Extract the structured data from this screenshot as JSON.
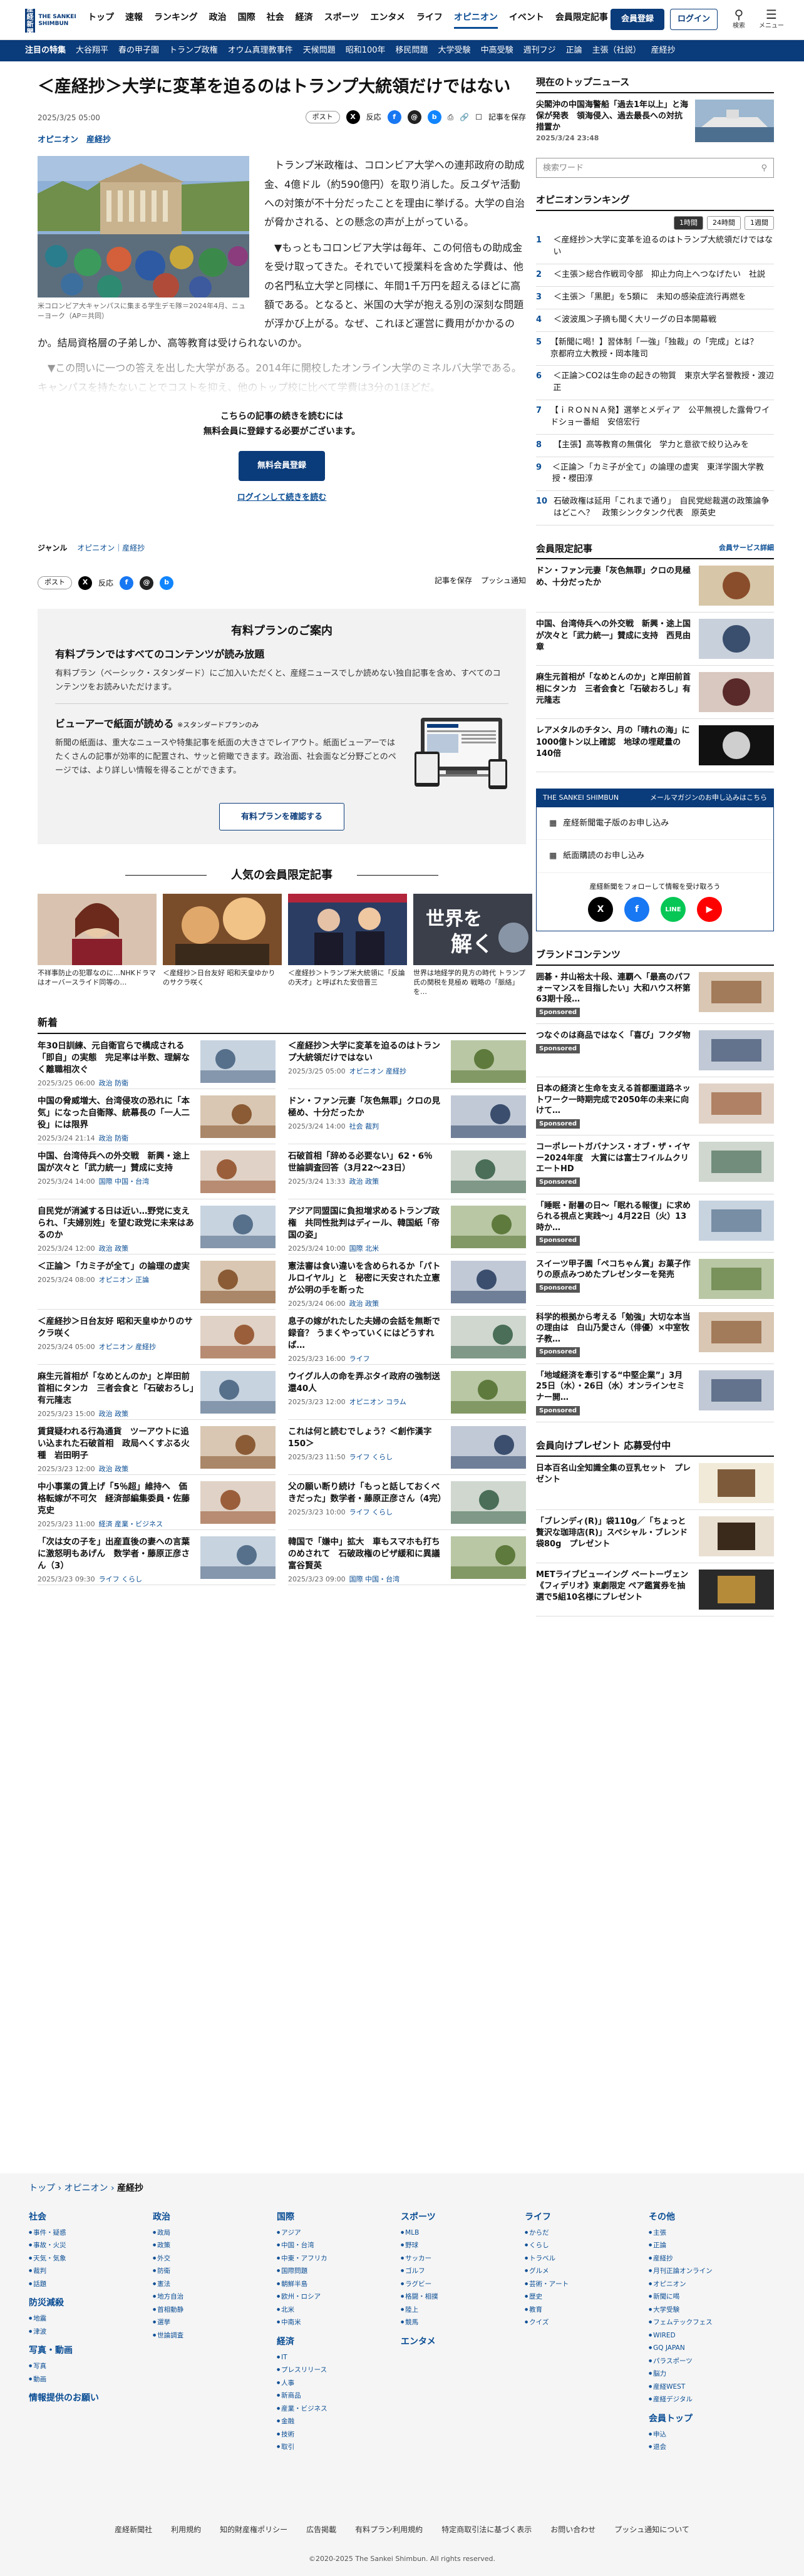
{
  "header": {
    "logo_text": "THE SANKEI SHIMBUN",
    "logo_mark": "産経新聞",
    "nav": [
      "トップ",
      "速報",
      "ランキング",
      "政治",
      "国際",
      "社会",
      "経済",
      "スポーツ",
      "エンタメ",
      "ライフ",
      "オピニオン",
      "イベント",
      "会員限定記事"
    ],
    "active_nav": "オピニオン",
    "register_label": "会員登録",
    "login_label": "ログイン",
    "search_label": "検索",
    "menu_label": "メニュー"
  },
  "topic_bar": {
    "label": "注目の特集",
    "items": [
      "大谷翔平",
      "春の甲子園",
      "トランプ政権",
      "オウム真理教事件",
      "天候問題",
      "昭和100年",
      "移民問題",
      "大学受験",
      "中高受験",
      "週刊フジ",
      "正論",
      "主張（社説）",
      "産経抄"
    ]
  },
  "article": {
    "headline": "＜産経抄＞大学に変革を迫るのはトランプ大統領だけではない",
    "date": "2025/3/25 05:00",
    "share_post": "ポスト",
    "share_reaction": "反応",
    "save_label": "記事を保存",
    "categories": [
      "オピニオン",
      "産経抄"
    ],
    "photo_caption": "米コロンビア大キャンパスに集まる学生デモ隊＝2024年4月、ニューヨーク（AP＝共同）",
    "para1": "トランプ米政権は、コロンビア大学への連邦政府の助成金、4億ドル（約590億円）を取り消した。反ユダヤ活動への対策が不十分だったことを理由に挙げる。大学の自治が脅かされる、との懸念の声が上がっている。",
    "para2": "▼もっともコロンビア大学は毎年、この何倍もの助成金を受け取ってきた。それでいて授業料を含めた学費は、他の名門私立大学と同様に、年間1千万円を超えるほどに高額である。となると、米国の大学が抱える別の深刻な問題が浮かび上がる。なぜ、これほど運営に費用がかかるのか。結局資格層の子弟しか、高等教育は受けられないのか。",
    "para3": "▼この問いに一つの答えを出した大学がある。2014年に開校したオンライン大学のミネルバ大学である。キャンパスを持たないことでコストを抑え、他のトップ校に比べて学費は3分の1ほどだ。",
    "paywall_line1": "こちらの記事の続きを読むには",
    "paywall_line2": "無料会員に登録する必要がございます。",
    "paywall_button": "無料会員登録",
    "paywall_login": "ログインして続きを読む",
    "genre_label": "ジャンル",
    "genre_values": "オピニオン｜産経抄",
    "push_label": "プッシュ通知"
  },
  "plan": {
    "title": "有料プランのご案内",
    "h1": "有料プランではすべてのコンテンツが読み放題",
    "p1": "有料プラン（ベーシック・スタンダード）にご加入いただくと、産経ニュースでしか読めない独自記事を含め、すべてのコンテンツをお読みいただけます。",
    "h2": "ビューアーで紙面が読める",
    "h2_note": "※スタンダードプランのみ",
    "p2": "新聞の紙面は、重大なニュースや特集記事を紙面の大きさでレイアウト。紙面ビューアーではたくさんの記事が効率的に配置され、サッと俯瞰できます。政治面、社会面など分野ごとのページでは、より詳しい情報を得ることができます。",
    "button": "有料プランを確認する"
  },
  "popular": {
    "title": "人気の会員限定記事",
    "items": [
      {
        "title": "不祥事防止の犯罪なのに…NHKドラマはオーバースライド同等の…"
      },
      {
        "title": "＜産経抄＞日台友好 昭和天皇ゆかりのサクラ咲く"
      },
      {
        "title": "＜産経抄＞トランプ米大統領に「反論の天才」と呼ばれた安倍晋三"
      },
      {
        "title": "世界は地経学的見方の時代 トランプ氏の関税を見極め 戦略の「脈絡」を…"
      }
    ]
  },
  "new_list": {
    "title": "新着",
    "items": [
      {
        "title": "年30日訓練、元自衛官らで構成される「即自」の実態　完足率は半数、理解なく離職相次ぐ",
        "date": "2025/3/25 06:00",
        "cat": "政治 防衛"
      },
      {
        "title": "＜産経抄＞大学に変革を迫るのはトランプ大統領だけではない",
        "date": "2025/3/25 05:00",
        "cat": "オピニオン 産経抄"
      },
      {
        "title": "中国の脅威増大、台湾侵攻の恐れに「本気」になった自衛隊、統幕長の「一人二役」には限界",
        "date": "2025/3/24 21:14",
        "cat": "政治 防衛"
      },
      {
        "title": "ドン・ファン元妻「灰色無罪」クロの見極め、十分だったか",
        "date": "2025/3/24 14:00",
        "cat": "社会 裁判"
      },
      {
        "title": "中国、台湾侍兵への外交戦　新興・途上国が次々と「武力統一」賛成に支持",
        "date": "2025/3/24 14:00",
        "cat": "国際 中国・台湾"
      },
      {
        "title": "石破首相「辞める必要ない」62・6％　世論調査回答（3月22～23日）",
        "date": "2025/3/24 13:33",
        "cat": "政治 政策"
      },
      {
        "title": "自民党が消滅する日は近い…野党に支えられ、「夫婦別姓」を望む政党に未来はあるのか",
        "date": "2025/3/24 12:00",
        "cat": "政治 政策"
      },
      {
        "title": "アジア同盟国に負担増求めるトランプ政権　共同性批判はディール、韓国紙「帝国の姿」",
        "date": "2025/3/24 10:00",
        "cat": "国際 北米"
      },
      {
        "title": "＜正論＞「カミ子が全て」の論理の虚実",
        "date": "2025/3/24 08:00",
        "cat": "オピニオン 正論"
      },
      {
        "title": "憲法審は食い違いを含められるか「パトルロイヤル」と　秘密に天安された立憲が公明の手を断った",
        "date": "2025/3/24 06:00",
        "cat": "政治 政策"
      },
      {
        "title": "＜産経抄＞日台友好 昭和天皇ゆかりのサクラ咲く",
        "date": "2025/3/24 05:00",
        "cat": "オピニオン 産経抄"
      },
      {
        "title": "息子の嫁がれたした夫婦の会話を無断で録音？ うまくやっていくにはどうすれば…",
        "date": "2025/3/23 16:00",
        "cat": "ライフ"
      },
      {
        "title": "麻生元首相が「なめとんのか」と岸田前首相にタンカ　三者会食と「石破おろし」有元隆志",
        "date": "2025/3/23 15:00",
        "cat": "政治 政策"
      },
      {
        "title": "ウイグル人の命を弄ぶタイ政府の強制送還40人",
        "date": "2025/3/23 12:00",
        "cat": "オピニオン コラム"
      },
      {
        "title": "賃貸疑われる行為通貨　ツーアウトに追い込まれた石破首相　政局へくすぶる火種　岩田明子",
        "date": "2025/3/23 12:00",
        "cat": "政治 政策"
      },
      {
        "title": "これは何と読むでしょう？＜創作漢字150＞",
        "date": "2025/3/23 11:50",
        "cat": "ライフ くらし"
      },
      {
        "title": "中小事業の賃上げ「5％超」維持へ　価格転嫁が不可欠　経済部編集委員・佐藤克史",
        "date": "2025/3/23 11:00",
        "cat": "経済 産業・ビジネス"
      },
      {
        "title": "父の願い断り続け「もっと話しておくべきだった」数学者・藤原正彦さん（4完）",
        "date": "2025/3/23 10:00",
        "cat": "ライフ くらし"
      },
      {
        "title": "「次は女の子を」出産直後の妻への言葉に激怒明もあげん　数学者・藤原正彦さん（3）",
        "date": "2025/3/23 09:30",
        "cat": "ライフ くらし"
      },
      {
        "title": "韓国で「嫌中」拡大　車もスマホも打ちのめされて　石破政権のビザ緩和に異議　富谷賢英",
        "date": "2025/3/23 09:00",
        "cat": "国際 中国・台湾"
      }
    ]
  },
  "sidebar": {
    "top_news_h": "現在のトップニュース",
    "top_news_t": "尖閣沖の中国海警船「過去1年以上」と海保が発表　領海侵入、過去最長への対抗措置か",
    "top_news_d": "2025/3/24 23:48",
    "search_placeholder": "検索ワード",
    "ranking_h": "オピニオンランキング",
    "ranking_tabs": [
      "1時間",
      "24時間",
      "1週間"
    ],
    "ranking": [
      "＜産経抄＞大学に変革を迫るのはトランプ大統領だけではない",
      "＜主張＞総合作戦司令部　抑止力向上へつなげたい　社説",
      "＜主張＞「黒肥」を5類に　未知の感染症流行再燃を",
      "＜波波風＞子摘も聞く大リーグの日本開幕戦",
      "【新聞に喝！】習体制「一強」「独裁」の「完成」とは？　京都府立大教授・岡本隆司",
      "＜正論＞CO2は生命の起きの物質　東京大学名誉教授・渡辺正",
      "【ｉＲＯＮＮＡ発】選挙とメディア　公平無視した露骨ワイドショー番組　安倍宏行",
      "【主張】高等教育の無償化　学力と意欲で絞り込みを",
      "＜正論＞「カミ子が全て」の論理の虚実　東洋学園大学教授・櫻田淳",
      "石破政権は延用「これまで通り」　自民党総裁選の政策論争はどこへ？　政策シンクタンク代表　原英史"
    ],
    "member_h": "会員限定記事",
    "member_service": "会員サービス詳細",
    "member": [
      "ドン・ファン元妻「灰色無罪」クロの見極め、十分だったか",
      "中国、台湾侍兵への外交戦　新興・途上国が次々と「武力統一」賛成に支持　西見由章",
      "麻生元首相が「なめとんのか」と岸田前首相にタンカ　三者会食と「石破おろし」有元隆志",
      "レアメタルのチタン、月の「晴れの海」に1000億トン以上確認　地球の埋蔵量の140倍"
    ],
    "sankei_box_title": "THE SANKEI SHIMBUN",
    "sankei_box_right": "メールマガジンのお申し込みはこちら",
    "sankei_rows": [
      "産経新聞電子版のお申し込み",
      "紙面購読のお申し込み"
    ],
    "follow_text": "産経新聞をフォローして情報を受け取ろう",
    "brand_h": "ブランドコンテンツ",
    "brand": [
      "囲碁・井山裕太十段、連覇へ「最高のパフォーマンスを目指したい」大和ハウス杯第63期十段…",
      "つなぐのは商品ではなく「喜び」フクダ物",
      "日本の経済と生命を支える首都圏道路ネットワーク一時期完成で2050年の未来に向けて…",
      "コーポレートガバナンス・オブ・ザ・イヤー2024年度　大賞には富士フイルムクリエートHD",
      "「睡眠・耐暑の日～「眠れる報復」に求められる視点と実践～」4月22日（火）13時か…",
      "スイーツ甲子園「ペコちゃん賞」お菓子作りの原点みつめたプレゼンターを発売",
      "科学的根拠から考える「勉強」大切な本当の理由は　白山乃愛さん（俳優）×中室牧子教…",
      "「地域経済を牽引する“中堅企業”」3月25日（水）・26日（水）オンラインセミナー開…"
    ],
    "sponsored": "Sponsored",
    "present_h": "会員向けプレゼント 応募受付中",
    "present": [
      "日本百名山全知識全集の豆乳セット　プレゼント",
      "「ブレンディ(R)」袋110g／「ちょっと贅沢な珈琲店(R)」スペシャル・ブレンド袋80g　プレゼント",
      "METライブビューイング ベートーヴェン《フィデリオ》東劇限定 ペア鑑賞券を抽選で5組10名様にプレゼント"
    ]
  },
  "footer": {
    "breadcrumb": [
      "トップ",
      "オピニオン",
      "産経抄"
    ],
    "cols": [
      {
        "h": "社会",
        "items": [
          "事件・疑惑",
          "事故・火災",
          "天気・気象",
          "裁判",
          "話題"
        ],
        "h2": "防災減殺",
        "items2": [
          "地震",
          "津波"
        ],
        "h3": "写真・動画",
        "items3": [
          "写真",
          "動画"
        ],
        "h4": "情報提供のお願い",
        "items4": []
      },
      {
        "h": "政治",
        "items": [
          "政局",
          "政策",
          "外交",
          "防衛",
          "憲法",
          "地方自治",
          "首相動静",
          "選挙",
          "世論調査"
        ],
        "h2": "",
        "items2": [],
        "h3": "",
        "items3": [],
        "h4": "",
        "items4": []
      },
      {
        "h": "国際",
        "items": [
          "アジア",
          "中国・台湾",
          "中東・アフリカ",
          "国際問題",
          "朝鮮半島",
          "欧州・ロシア",
          "北米",
          "中南米"
        ],
        "h2": "経済",
        "items2": [
          "IT",
          "プレスリリース",
          "人事",
          "新商品",
          "産業・ビジネス",
          "金融",
          "技術",
          "取引"
        ],
        "h3": "",
        "items3": [],
        "h4": "",
        "items4": []
      },
      {
        "h": "スポーツ",
        "items": [
          "MLB",
          "野球",
          "サッカー",
          "ゴルフ",
          "ラグビー",
          "格闘・相撲",
          "陸上",
          "競馬"
        ],
        "h2": "エンタメ",
        "items2": [],
        "h3": "",
        "items3": [],
        "h4": "",
        "items4": []
      },
      {
        "h": "ライフ",
        "items": [
          "からだ",
          "くらし",
          "トラベル",
          "グルメ",
          "芸術・アート",
          "歴史",
          "教育",
          "クイズ"
        ],
        "h2": "",
        "items2": [],
        "h3": "",
        "items3": [],
        "h4": "",
        "items4": []
      },
      {
        "h": "その他",
        "items": [
          "主張",
          "正論",
          "産経抄",
          "月刊正論オンライン",
          "オピニオン",
          "新聞に喝",
          "大学受験",
          "フェムテックフェス",
          "WIRED",
          "GQ JAPAN",
          "パラスポーツ",
          "脳力",
          "産経WEST",
          "産経デジタル"
        ],
        "h2": "会員トップ",
        "items2": [
          "申込",
          "退会"
        ],
        "h3": "",
        "items3": [],
        "h4": "",
        "items4": []
      }
    ],
    "links": [
      "産経新聞社",
      "利用規約",
      "知的財産権ポリシー",
      "広告掲載",
      "有料プラン利用規約",
      "特定商取引法に基づく表示",
      "お問い合わせ",
      "プッシュ通知について"
    ],
    "copyright": "©2020-2025 The Sankei Shimbun. All rights reserved."
  }
}
